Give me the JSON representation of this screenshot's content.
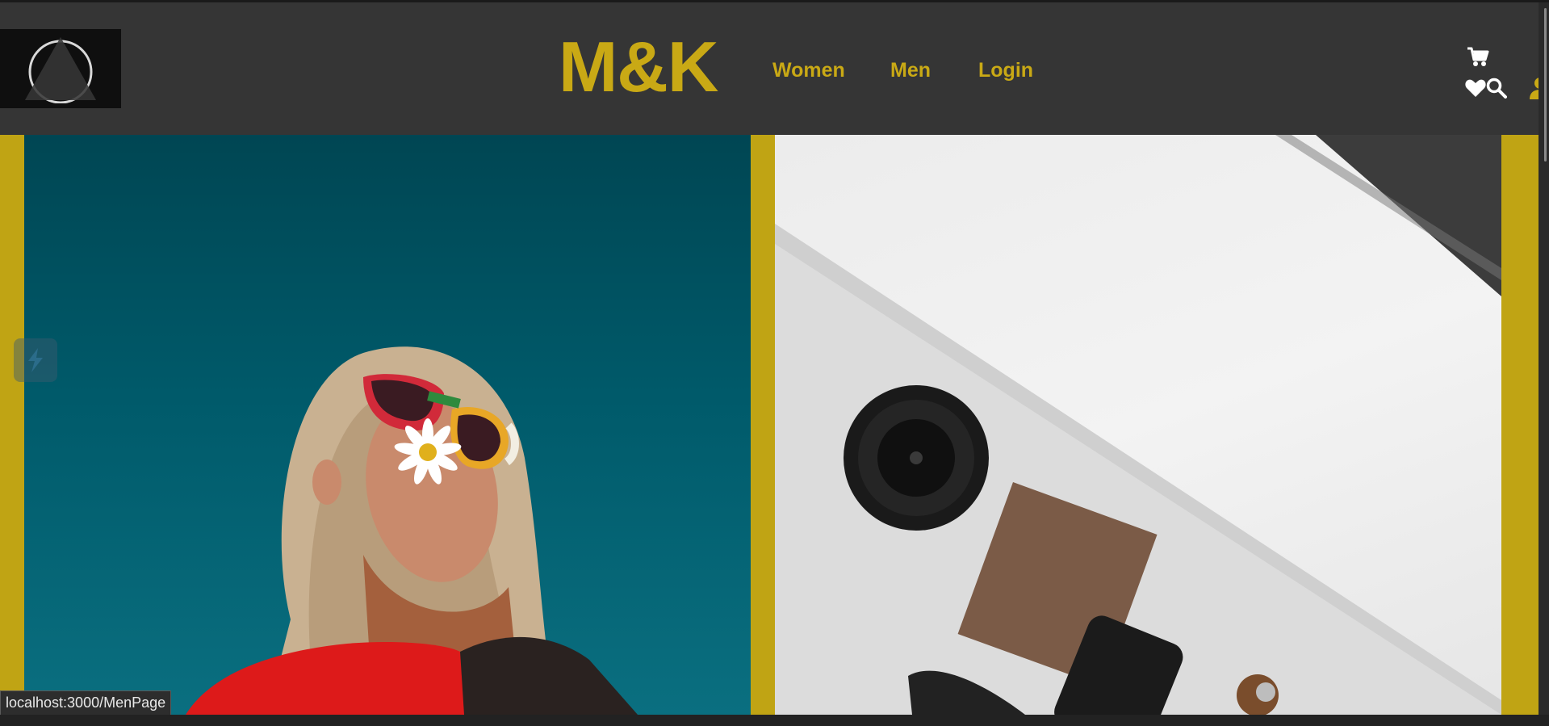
{
  "header": {
    "brand": "M&K",
    "nav": [
      {
        "label": "Women"
      },
      {
        "label": "Men"
      },
      {
        "label": "Login"
      }
    ],
    "icons": [
      "cart-icon",
      "heart-icon",
      "search-icon",
      "user-icon"
    ]
  },
  "hero": {
    "left_image": "woman-with-sunglasses-and-daisy",
    "right_image": "camera-lens-and-accessories"
  },
  "status_bar": {
    "url": "localhost:3000/MenPage"
  },
  "colors": {
    "accent": "#c9a915",
    "navbar": "#353535",
    "background": "#c0a414"
  }
}
